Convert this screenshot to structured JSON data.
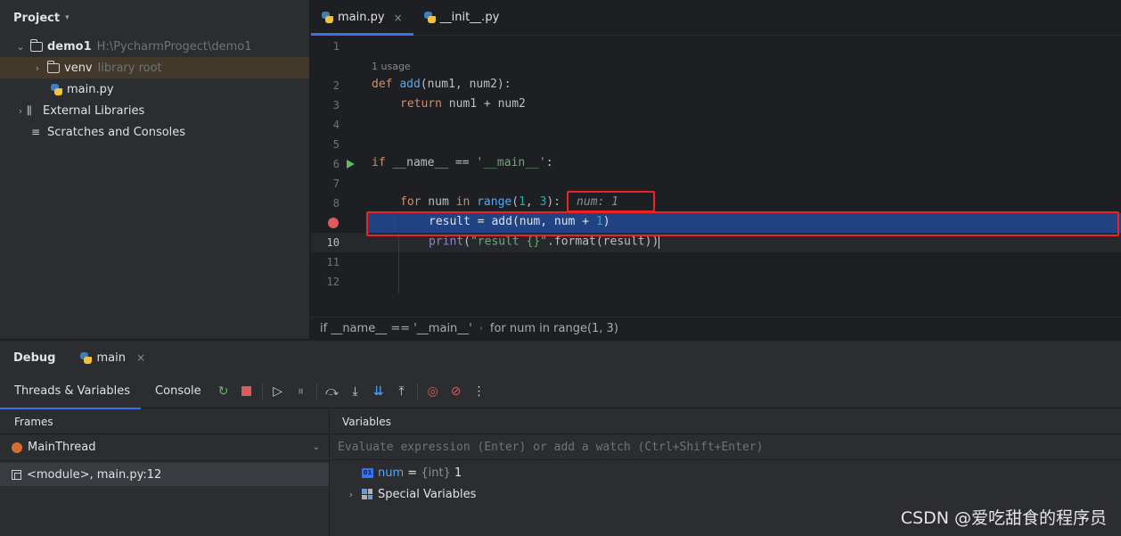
{
  "project": {
    "title": "Project",
    "items": [
      {
        "name": "demo1",
        "path": "H:\\PycharmProgect\\demo1"
      },
      {
        "name": "venv",
        "hint": "library root"
      },
      {
        "name": "main.py"
      },
      {
        "name": "External Libraries"
      },
      {
        "name": "Scratches and Consoles"
      }
    ]
  },
  "editor": {
    "tabs": [
      {
        "label": "main.py",
        "close": "×"
      },
      {
        "label": "__init__.py"
      }
    ],
    "usage_hint": "1 usage",
    "line_numbers": [
      "1",
      "2",
      "3",
      "4",
      "5",
      "6",
      "7",
      "8",
      "9",
      "10",
      "11",
      "12"
    ],
    "code": {
      "l2_kw": "def",
      "l2_fn": "add",
      "l2_rest": "(num1, num2):",
      "l3_kw": "return",
      "l3_rest": " num1 + num2",
      "l6_kw": "if",
      "l6_mid": " __name__ == ",
      "l6_str": "'__main__'",
      "l6_end": ":",
      "l8_kw": "for",
      "l8_a": " num ",
      "l8_in": "in",
      "l8_sp": " ",
      "l8_fn": "range",
      "l8_p1": "(",
      "l8_n1": "1",
      "l8_c": ", ",
      "l8_n2": "3",
      "l8_p2": "):",
      "l8_inline": "num: 1",
      "l9_a": "result = ",
      "l9_fn": "add",
      "l9_b": "(num, num + ",
      "l9_n": "1",
      "l9_c": ")",
      "l10_fn": "print",
      "l10_p": "(",
      "l10_str": "\"result {}\"",
      "l10_rest": ".format(result))"
    },
    "breadcrumb": [
      "if __name__ == '__main__'",
      "for num in range(1, 3)"
    ],
    "breadcrumb_sep": "›"
  },
  "debug": {
    "title": "Debug",
    "session_tab": "main",
    "session_close": "×",
    "sub_tabs": [
      "Threads & Variables",
      "Console"
    ],
    "frames_title": "Frames",
    "thread_name": "MainThread",
    "frame": "<module>, main.py:12",
    "variables_title": "Variables",
    "eval_placeholder": "Evaluate expression (Enter) or add a watch (Ctrl+Shift+Enter)",
    "variables": [
      {
        "badge": "01",
        "name": "num",
        "eq": " = ",
        "type": "{int}",
        "value": " 1"
      },
      {
        "name": "Special Variables"
      }
    ]
  },
  "watermark": "CSDN @爱吃甜食的程序员",
  "colors": {
    "accent": "#3574f0",
    "breakpoint": "#db5c5c",
    "selection": "#214283",
    "highlight_box": "#ee2222"
  }
}
